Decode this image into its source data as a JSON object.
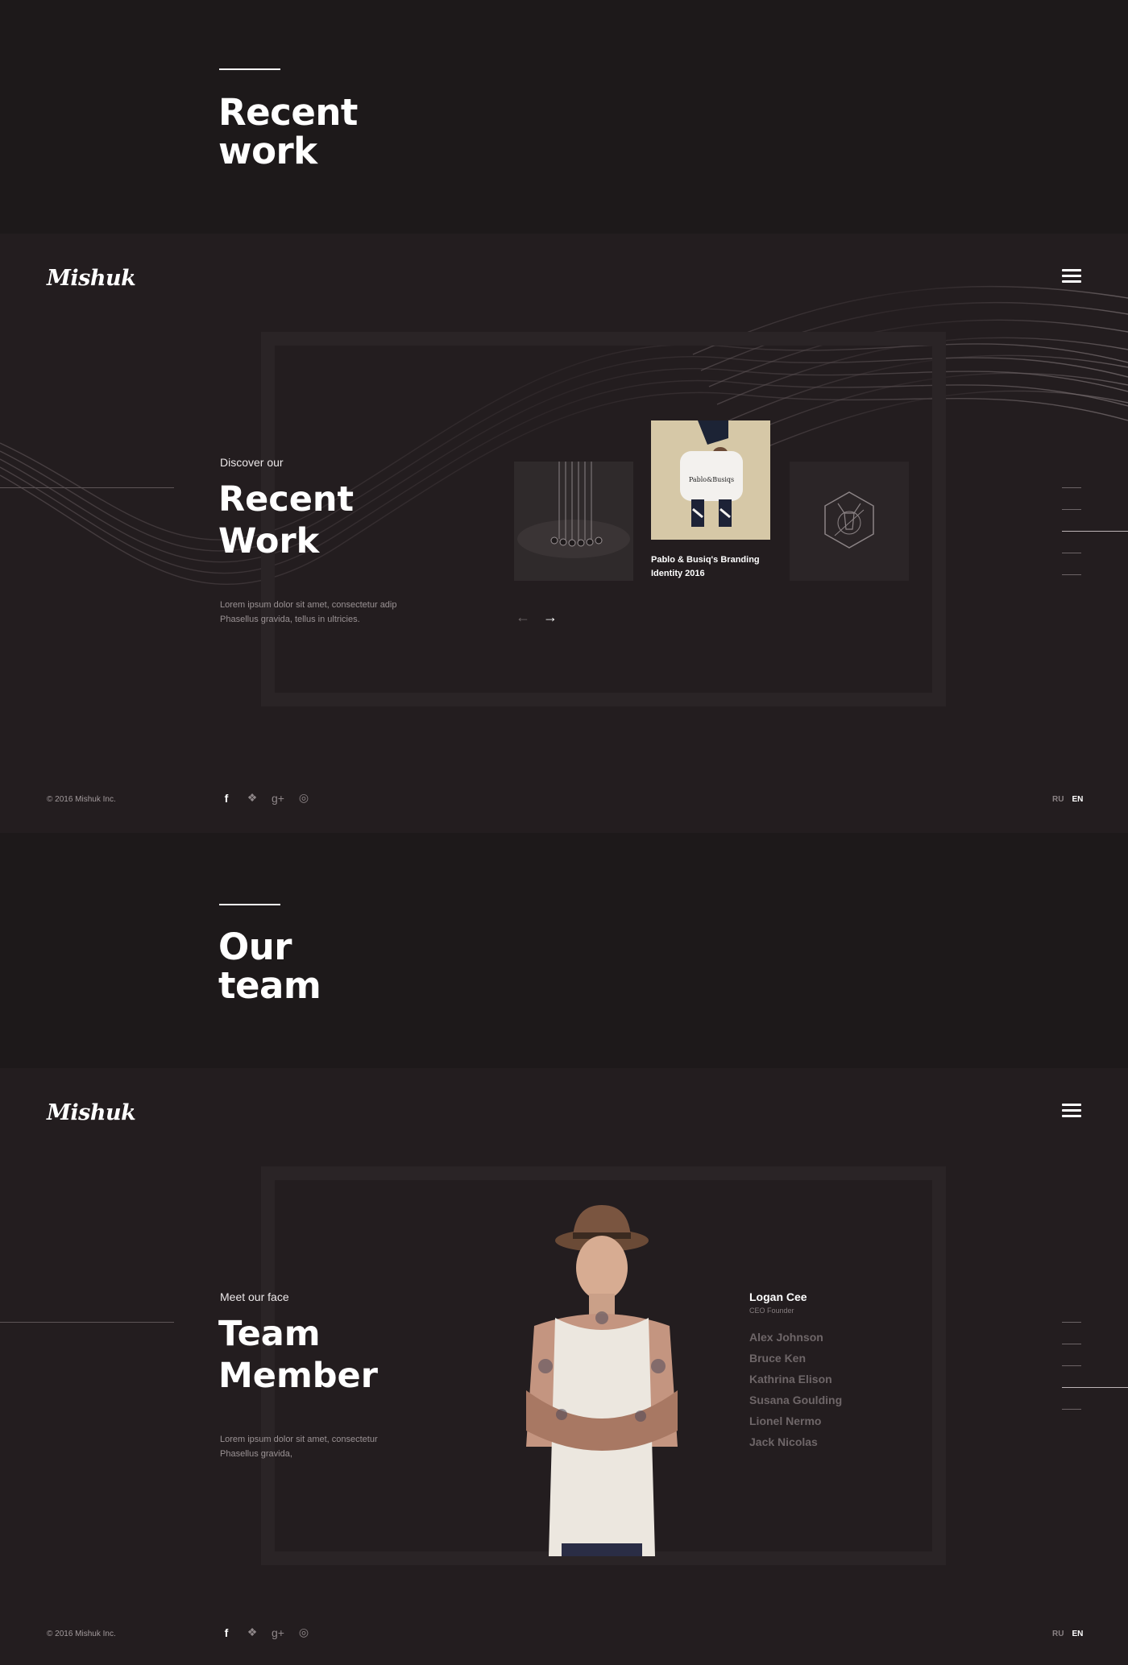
{
  "sections": {
    "recent_work_band": {
      "title": "Recent\nwork"
    },
    "team_band": {
      "title": "Our\nteam"
    }
  },
  "brand": {
    "logo": "Mishuk"
  },
  "work_screen": {
    "eyebrow": "Discover our",
    "heading": "Recent\nWork",
    "description": "Lorem ipsum dolor sit amet, consectetur adip\nPhasellus gravida, tellus in ultricies.",
    "featured_caption": "Pablo & Busiq's Branding\nIdentity 2016",
    "card_brand_text": "Pablo&Busiqs",
    "prev_icon": "arrow-left-icon",
    "next_icon": "arrow-right-icon"
  },
  "team_screen": {
    "eyebrow": "Meet our face",
    "heading": "Team\nMember",
    "description": "Lorem ipsum dolor sit amet, consectetur\nPhasellus gravida,",
    "active_member": {
      "name": "Logan Cee",
      "role": "CEO Founder"
    },
    "members": [
      "Alex Johnson",
      "Bruce Ken",
      "Kathrina Elison",
      "Susana Goulding",
      "Lionel Nermo",
      "Jack Nicolas"
    ]
  },
  "footer": {
    "copyright": "© 2016 Mishuk Inc.",
    "social": [
      "facebook-icon",
      "twitter-icon",
      "google-plus-icon",
      "dribbble-icon"
    ],
    "languages": [
      "RU",
      "EN"
    ],
    "active_language": "EN"
  },
  "colors": {
    "background": "#1d191a",
    "screen": "#231d1f",
    "frame": "#2a2426",
    "muted": "#6e6668"
  }
}
